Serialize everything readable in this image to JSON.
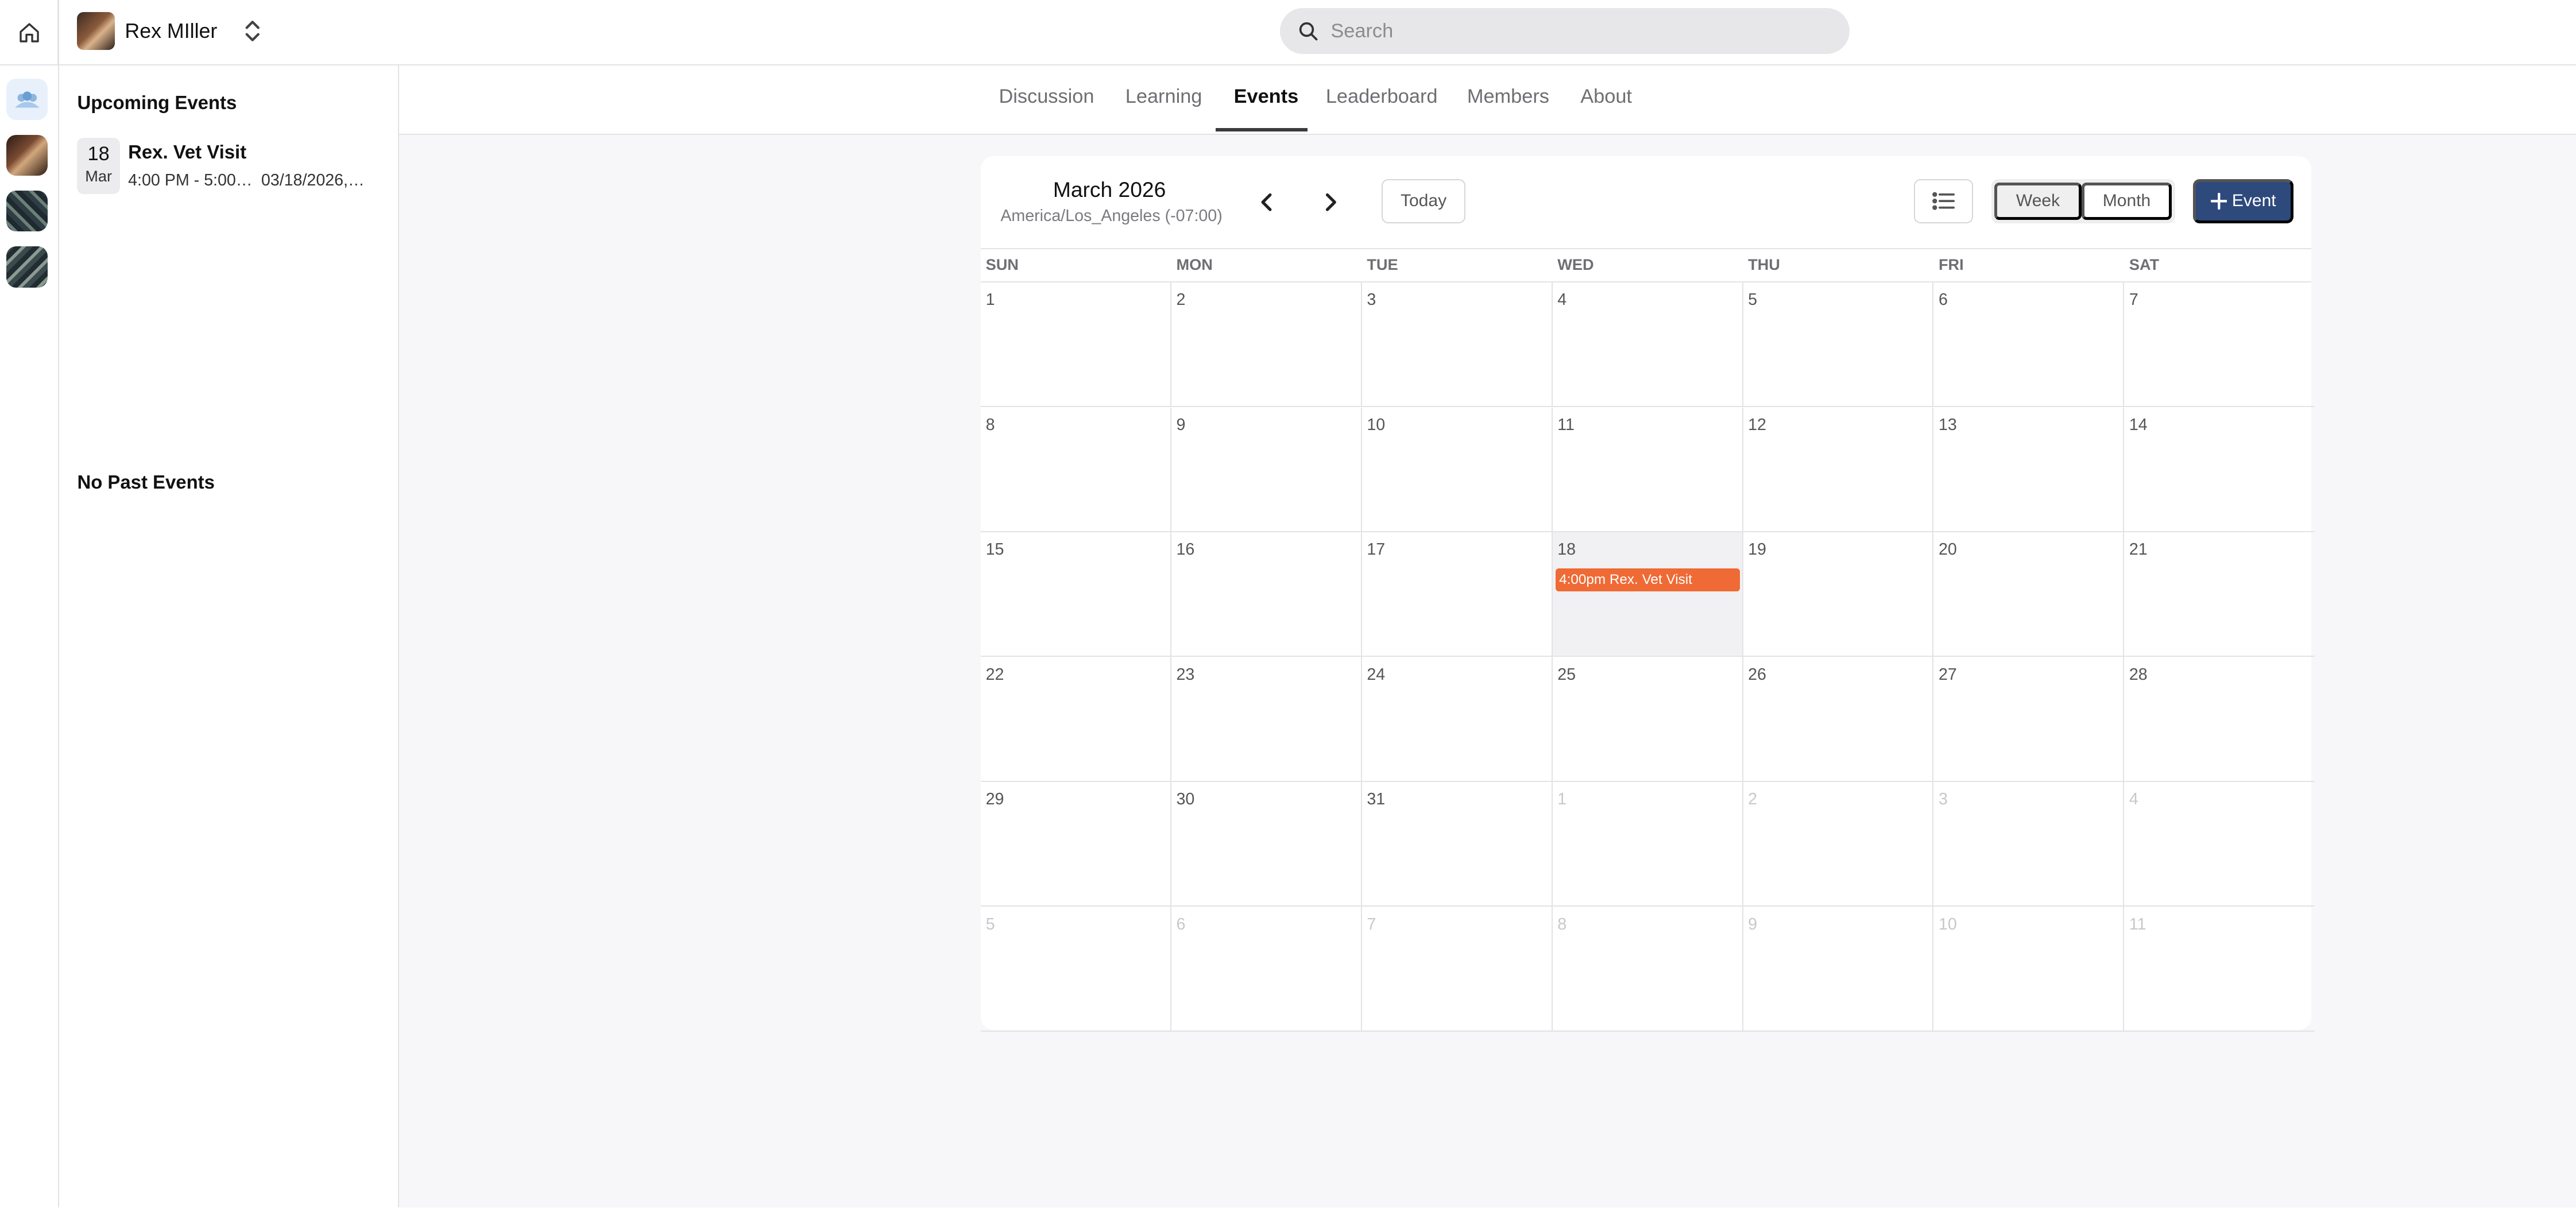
{
  "profile": {
    "name": "Rex MIller"
  },
  "search": {
    "placeholder": "Search"
  },
  "sidebar": {
    "upcoming_title": "Upcoming Events",
    "upcoming": [
      {
        "day": "18",
        "month": "Mar",
        "title": "Rex. Vet Visit",
        "time": "4:00 PM - 5:00…",
        "date": "03/18/2026,…"
      }
    ],
    "past_title": "No Past Events"
  },
  "tabs": [
    {
      "label": "Discussion",
      "active": false
    },
    {
      "label": "Learning",
      "active": false
    },
    {
      "label": "Events",
      "active": true
    },
    {
      "label": "Leaderboard",
      "active": false
    },
    {
      "label": "Members",
      "active": false
    },
    {
      "label": "About",
      "active": false
    }
  ],
  "calendar": {
    "month_label": "March 2026",
    "timezone": "America/Los_Angeles (-07:00)",
    "today_label": "Today",
    "week_label": "Week",
    "month_view_label": "Month",
    "add_event_label": "Event",
    "weekdays": [
      "SUN",
      "MON",
      "TUE",
      "WED",
      "THU",
      "FRI",
      "SAT"
    ],
    "weeks": [
      [
        "1",
        "2",
        "3",
        "4",
        "5",
        "6",
        "7"
      ],
      [
        "8",
        "9",
        "10",
        "11",
        "12",
        "13",
        "14"
      ],
      [
        "15",
        "16",
        "17",
        "18",
        "19",
        "20",
        "21"
      ],
      [
        "22",
        "23",
        "24",
        "25",
        "26",
        "27",
        "28"
      ],
      [
        "29",
        "30",
        "31",
        "1",
        "2",
        "3",
        "4"
      ],
      [
        "5",
        "6",
        "7",
        "8",
        "9",
        "10",
        "11"
      ]
    ],
    "outside_month": [
      [
        4,
        3
      ],
      [
        4,
        4
      ],
      [
        4,
        5
      ],
      [
        4,
        6
      ],
      [
        5,
        0
      ],
      [
        5,
        1
      ],
      [
        5,
        2
      ],
      [
        5,
        3
      ],
      [
        5,
        4
      ],
      [
        5,
        5
      ],
      [
        5,
        6
      ]
    ],
    "today_cell": [
      2,
      3
    ],
    "events": [
      {
        "week": 2,
        "day": 3,
        "label": "4:00pm Rex. Vet Visit"
      }
    ],
    "event_color": "#ef6a35"
  },
  "colors": {
    "accent": "#2e4a7d"
  }
}
